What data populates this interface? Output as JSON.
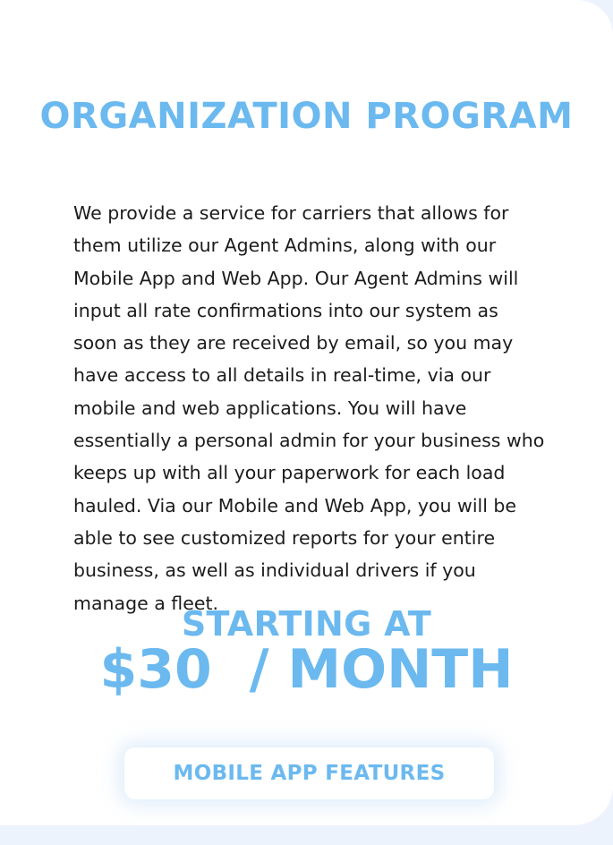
{
  "section": {
    "title": "ORGANIZATION PROGRAM",
    "description": "We provide a service for carriers that allows for them utilize our Agent Admins, along with our Mobile App and Web App. Our Agent Admins will input all rate confirmations into our system as soon as they are received by email, so you may have access to all details in real-time, via our mobile and web applications. You will have essentially a personal admin for your business who keeps up with all your paperwork for each load hauled. Via our Mobile and Web App, you will be able to see customized reports for your entire business, as well as individual drivers if you manage a fleet."
  },
  "pricing": {
    "prefix": "STARTING AT",
    "price": "$30  / MONTH"
  },
  "cta": {
    "label": "MOBILE APP FEATURES"
  },
  "colors": {
    "accent": "#6bb9ef",
    "background": "#edf3fc",
    "card": "#ffffff",
    "text": "#1c1c1c"
  }
}
